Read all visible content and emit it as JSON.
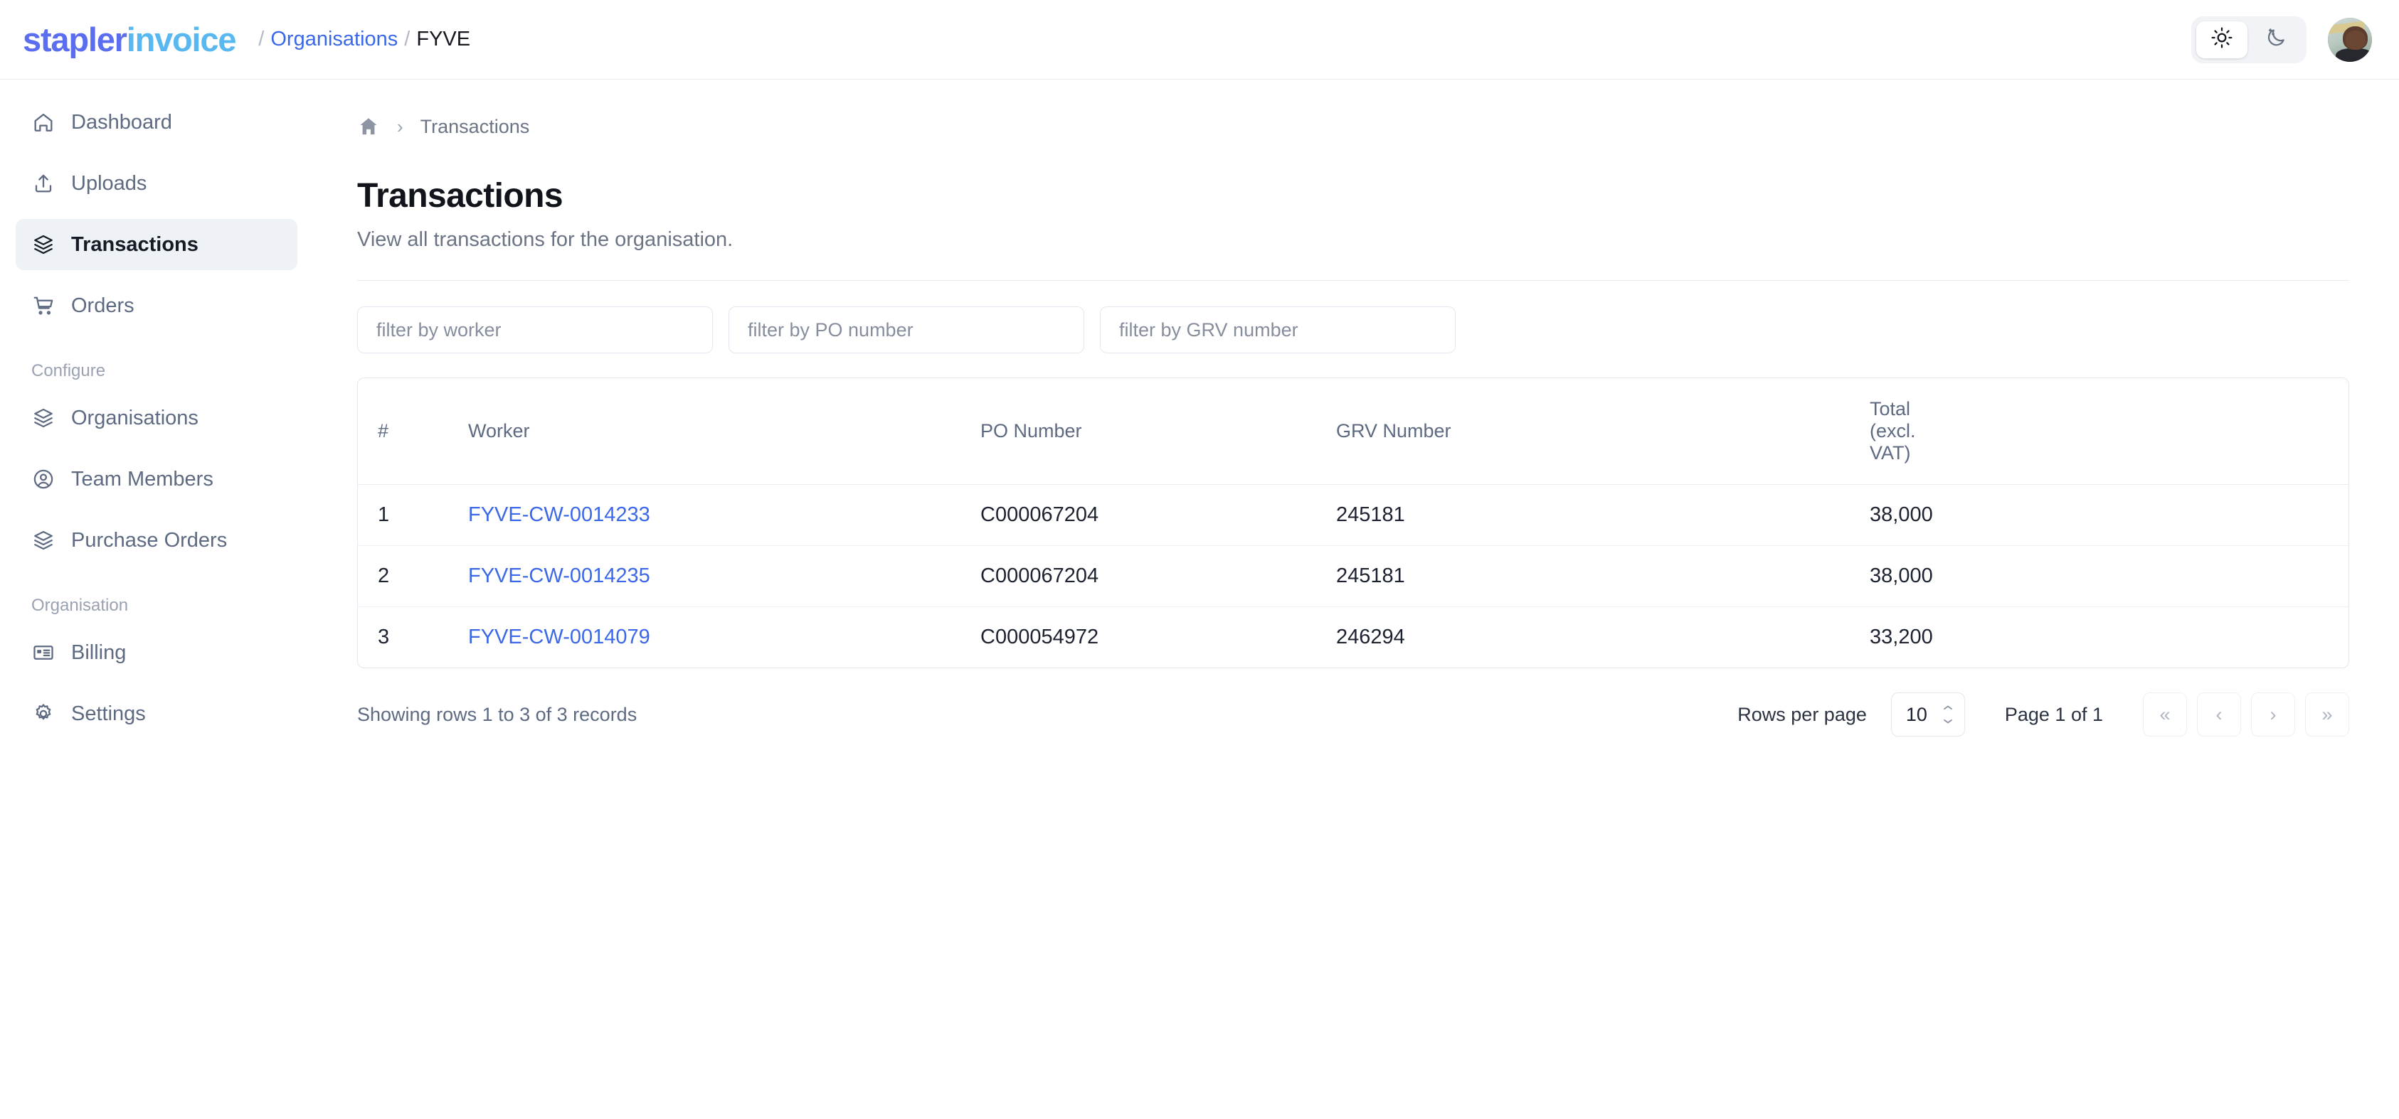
{
  "brand": {
    "name_part1": "stapler",
    "name_part2": "invoice",
    "color_primary": "#5b6ef0",
    "color_secondary": "#59b8ef"
  },
  "topbar": {
    "breadcrumb": [
      {
        "sep": "/",
        "label": "Organisations",
        "type": "link"
      },
      {
        "sep": "/",
        "label": "FYVE",
        "type": "current"
      }
    ],
    "theme": {
      "light_icon": "sun-icon",
      "dark_icon": "moon-icon",
      "active": "light"
    },
    "avatar_alt": "user-avatar"
  },
  "sidebar": {
    "items": [
      {
        "label": "Dashboard",
        "icon": "home-icon",
        "active": false
      },
      {
        "label": "Uploads",
        "icon": "upload-icon",
        "active": false
      },
      {
        "label": "Transactions",
        "icon": "layers-icon",
        "active": true
      },
      {
        "label": "Orders",
        "icon": "cart-icon",
        "active": false
      }
    ],
    "groups": [
      {
        "label": "Configure",
        "items": [
          {
            "label": "Organisations",
            "icon": "layers-icon"
          },
          {
            "label": "Team Members",
            "icon": "user-circle-icon"
          },
          {
            "label": "Purchase Orders",
            "icon": "layers-icon"
          }
        ]
      },
      {
        "label": "Organisation",
        "items": [
          {
            "label": "Billing",
            "icon": "card-icon"
          },
          {
            "label": "Settings",
            "icon": "gear-icon"
          }
        ]
      }
    ]
  },
  "main": {
    "breadcrumb": {
      "home_icon": "home-icon",
      "chevron": "›",
      "current": "Transactions"
    },
    "title": "Transactions",
    "subtitle": "View all transactions for the organisation.",
    "filters": [
      {
        "name": "worker",
        "placeholder": "filter by worker",
        "value": ""
      },
      {
        "name": "po_number",
        "placeholder": "filter by PO number",
        "value": ""
      },
      {
        "name": "grv_number",
        "placeholder": "filter by GRV number",
        "value": ""
      }
    ],
    "table": {
      "columns": [
        "#",
        "Worker",
        "PO Number",
        "GRV Number",
        "Total (excl. VAT)"
      ],
      "rows": [
        {
          "index": "1",
          "worker": "FYVE-CW-0014233",
          "po_number": "C000067204",
          "grv_number": "245181",
          "total": "38,000"
        },
        {
          "index": "2",
          "worker": "FYVE-CW-0014235",
          "po_number": "C000067204",
          "grv_number": "245181",
          "total": "38,000"
        },
        {
          "index": "3",
          "worker": "FYVE-CW-0014079",
          "po_number": "C000054972",
          "grv_number": "246294",
          "total": "33,200"
        }
      ]
    },
    "footer": {
      "showing": "Showing rows 1 to 3 of 3 records",
      "rows_per_page_label": "Rows per page",
      "rows_per_page_value": "10",
      "page_of": "Page 1 of 1",
      "buttons": [
        {
          "name": "first-page",
          "glyph": "«"
        },
        {
          "name": "prev-page",
          "glyph": "‹"
        },
        {
          "name": "next-page",
          "glyph": "›"
        },
        {
          "name": "last-page",
          "glyph": "»"
        }
      ]
    }
  },
  "colors": {
    "link": "#3b68e8",
    "active_nav_bg": "#eef1f6",
    "border": "#e3e7ee",
    "muted_text": "#5d6a82"
  }
}
